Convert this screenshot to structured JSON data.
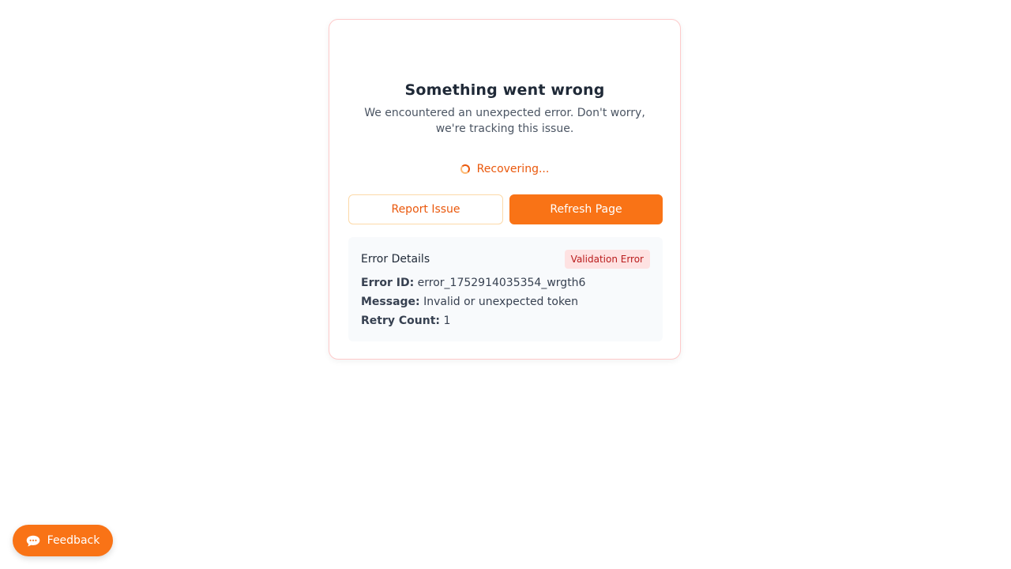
{
  "error": {
    "title": "Something went wrong",
    "subtitle": "We encountered an unexpected error. Don't worry, we're tracking this issue.",
    "status_text": "Recovering...",
    "spinner_icon": "spinner-icon"
  },
  "actions": {
    "report_label": "Report Issue",
    "refresh_label": "Refresh Page"
  },
  "details": {
    "title": "Error Details",
    "badge": "Validation Error",
    "error_id_label": "Error ID:",
    "error_id_value": "error_1752914035354_wrgth6",
    "message_label": "Message:",
    "message_value": "Invalid or unexpected token",
    "retry_label": "Retry Count:",
    "retry_value": "1"
  },
  "feedback": {
    "label": "Feedback",
    "icon": "speech-bubble-icon"
  },
  "colors": {
    "accent": "#f97316",
    "accent_text": "#ea580c",
    "badge_bg": "#fee2e2",
    "badge_text": "#b91c1c",
    "card_border": "#fecaca"
  }
}
